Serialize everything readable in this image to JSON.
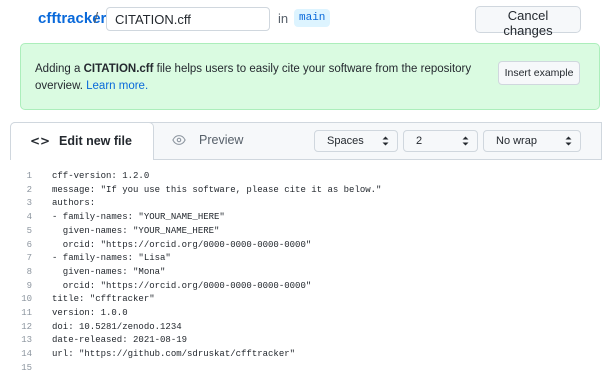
{
  "header": {
    "repo_name": "cfftracker",
    "separator": "/",
    "filename_value": "CITATION.cff",
    "in_label": "in",
    "branch": "main",
    "cancel_label": "Cancel changes"
  },
  "banner": {
    "text_before": "Adding a ",
    "text_bold": "CITATION.cff",
    "text_after": " file helps users to easily cite your software from the repository overview. ",
    "learn_more": "Learn more.",
    "insert_label": "Insert example",
    "bg_color": "#dafbe1"
  },
  "tabs": {
    "edit_icon": "<>",
    "edit_label": "Edit new file",
    "preview_label": "Preview"
  },
  "editor_options": {
    "indent_mode": "Spaces",
    "indent_size": "2",
    "wrap_mode": "No wrap"
  },
  "code": {
    "lines": [
      {
        "n": "1",
        "text": "cff-version: 1.2.0"
      },
      {
        "n": "2",
        "text": "message: \"If you use this software, please cite it as below.\""
      },
      {
        "n": "3",
        "text": "authors:"
      },
      {
        "n": "4",
        "text": "- family-names: \"YOUR_NAME_HERE\""
      },
      {
        "n": "5",
        "text": "  given-names: \"YOUR_NAME_HERE\""
      },
      {
        "n": "6",
        "text": "  orcid: \"https://orcid.org/0000-0000-0000-0000\""
      },
      {
        "n": "7",
        "text": "- family-names: \"Lisa\""
      },
      {
        "n": "8",
        "text": "  given-names: \"Mona\""
      },
      {
        "n": "9",
        "text": "  orcid: \"https://orcid.org/0000-0000-0000-0000\""
      },
      {
        "n": "10",
        "text": "title: \"cfftracker\""
      },
      {
        "n": "11",
        "text": "version: 1.0.0"
      },
      {
        "n": "12",
        "text": "doi: 10.5281/zenodo.1234"
      },
      {
        "n": "13",
        "text": "date-released: 2021-08-19"
      },
      {
        "n": "14",
        "text": "url: \"https://github.com/sdruskat/cfftracker\""
      },
      {
        "n": "15",
        "text": ""
      }
    ]
  }
}
